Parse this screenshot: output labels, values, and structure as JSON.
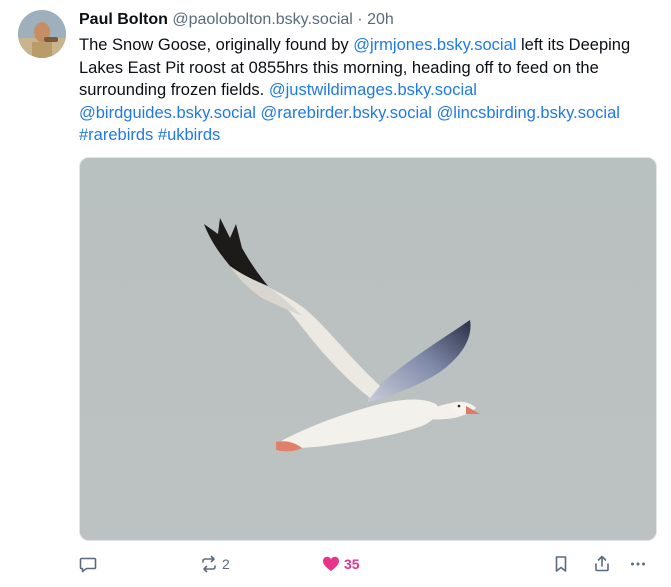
{
  "post": {
    "author": {
      "display_name": "Paul Bolton",
      "handle": "@paolobolton.bsky.social",
      "separator": "·",
      "timestamp": "20h"
    },
    "text": {
      "part1": "The Snow Goose, originally found by ",
      "mention1": "@jrmjones.bsky.social",
      "part2": " left its Deeping Lakes East Pit roost at 0855hrs this morning, heading off to feed on the surrounding frozen fields. ",
      "mention2": "@justwildimages.bsky.social",
      "mention3": "@birdguides.bsky.social",
      "mention4": "@rarebirder.bsky.social",
      "mention5": "@lincsbirding.bsky.social",
      "hashtag1": "#rarebirds",
      "hashtag2": "#ukbirds"
    },
    "actions": {
      "reply_icon": "reply-icon",
      "repost_icon": "repost-icon",
      "repost_count": "2",
      "like_icon": "heart-icon",
      "like_count": "35",
      "bookmark_icon": "bookmark-icon",
      "share_icon": "share-icon",
      "more_icon": "more-icon"
    }
  },
  "colors": {
    "link": "#1f7ae8",
    "muted": "#5b6b7c",
    "like": "#e8338a"
  }
}
